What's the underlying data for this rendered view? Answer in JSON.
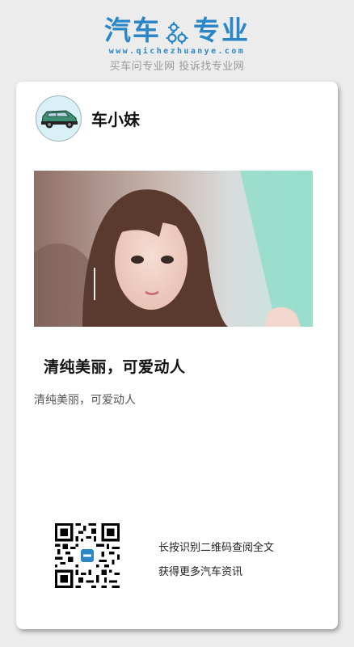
{
  "header": {
    "logo_text_left": "汽车",
    "logo_text_right": "专业",
    "logo_icon": "gears-icon",
    "url": "www.qichezhuanye.com",
    "slogan": "买车问专业网 投诉找专业网"
  },
  "author": {
    "avatar_icon": "car-icon",
    "name": "车小妹"
  },
  "article": {
    "image": "hero-photo",
    "title": "清纯美丽，可爱动人",
    "summary": "清纯美丽，可爱动人"
  },
  "qr": {
    "icon": "qr-code-icon",
    "line1": "长按识别二维码查阅全文",
    "line2": "获得更多汽车资讯"
  },
  "colors": {
    "brand": "#2a86c6",
    "background": "#ececec",
    "card": "#ffffff"
  }
}
